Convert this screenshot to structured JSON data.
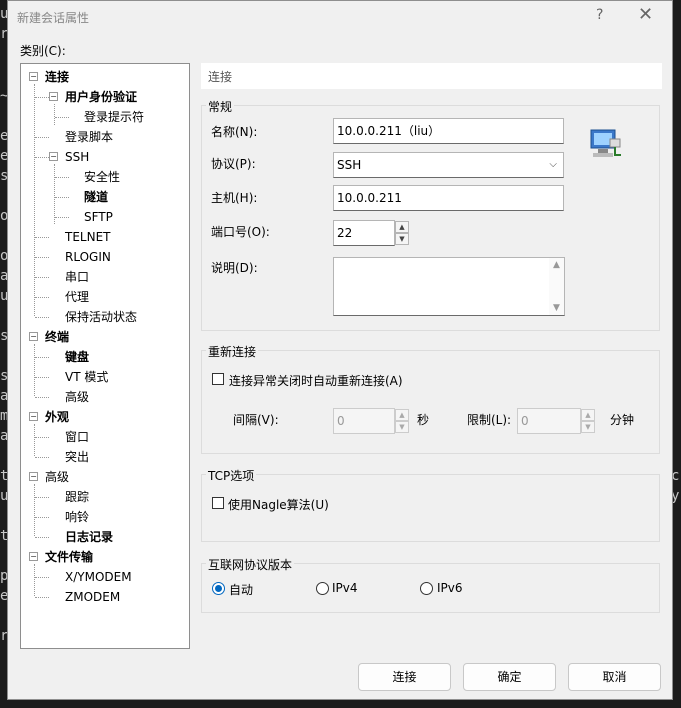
{
  "dialog": {
    "title": "新建会话属性",
    "help": "?",
    "close": "✕"
  },
  "category_label": "类别(C):",
  "tree": [
    {
      "label": "连接",
      "expander": "−",
      "bold": true
    },
    {
      "label": "用户身份验证",
      "expander": "−",
      "bold": true
    },
    {
      "label": "登录提示符",
      "expander": "",
      "bold": false
    },
    {
      "label": "登录脚本",
      "expander": "",
      "bold": false
    },
    {
      "label": "SSH",
      "expander": "−",
      "bold": false
    },
    {
      "label": "安全性",
      "expander": "",
      "bold": false
    },
    {
      "label": "隧道",
      "expander": "",
      "bold": true
    },
    {
      "label": "SFTP",
      "expander": "",
      "bold": false
    },
    {
      "label": "TELNET",
      "expander": "",
      "bold": false
    },
    {
      "label": "RLOGIN",
      "expander": "",
      "bold": false
    },
    {
      "label": "串口",
      "expander": "",
      "bold": false
    },
    {
      "label": "代理",
      "expander": "",
      "bold": false
    },
    {
      "label": "保持活动状态",
      "expander": "",
      "bold": false
    },
    {
      "label": "终端",
      "expander": "−",
      "bold": true
    },
    {
      "label": "键盘",
      "expander": "",
      "bold": true
    },
    {
      "label": "VT 模式",
      "expander": "",
      "bold": false
    },
    {
      "label": "高级",
      "expander": "",
      "bold": false
    },
    {
      "label": "外观",
      "expander": "−",
      "bold": true
    },
    {
      "label": "窗口",
      "expander": "",
      "bold": false
    },
    {
      "label": "突出",
      "expander": "",
      "bold": false
    },
    {
      "label": "高级",
      "expander": "−",
      "bold": false
    },
    {
      "label": "跟踪",
      "expander": "",
      "bold": false
    },
    {
      "label": "响铃",
      "expander": "",
      "bold": false
    },
    {
      "label": "日志记录",
      "expander": "",
      "bold": true
    },
    {
      "label": "文件传输",
      "expander": "−",
      "bold": true
    },
    {
      "label": "X/YMODEM",
      "expander": "",
      "bold": false
    },
    {
      "label": "ZMODEM",
      "expander": "",
      "bold": false
    }
  ],
  "panel": {
    "header": "连接",
    "general": {
      "title": "常规",
      "name_label": "名称(N):",
      "name_value": "10.0.0.211（liu）",
      "protocol_label": "协议(P):",
      "protocol_value": "SSH",
      "host_label": "主机(H):",
      "host_value": "10.0.0.211",
      "port_label": "端口号(O):",
      "port_value": "22",
      "desc_label": "说明(D):",
      "desc_value": ""
    },
    "reconnect": {
      "title": "重新连接",
      "auto_label": "连接异常关闭时自动重新连接(A)",
      "auto_checked": false,
      "interval_label": "间隔(V):",
      "interval_value": "0",
      "interval_unit": "秒",
      "limit_label": "限制(L):",
      "limit_value": "0",
      "limit_unit": "分钟"
    },
    "tcp": {
      "title": "TCP选项",
      "nagle_label": "使用Nagle算法(U)",
      "nagle_checked": false
    },
    "ip": {
      "title": "互联网协议版本",
      "options": [
        "自动",
        "IPv4",
        "IPv6"
      ],
      "selected": "自动"
    }
  },
  "buttons": {
    "connect": "连接",
    "ok": "确定",
    "cancel": "取消"
  },
  "background_chars": [
    "u",
    "r",
    "~",
    "e",
    "e",
    "s",
    "o",
    "o",
    "a",
    "u",
    "s",
    "s",
    "a",
    "m",
    "a",
    "t",
    "u",
    "t",
    "p",
    "e",
    "r",
    "c",
    "y"
  ]
}
